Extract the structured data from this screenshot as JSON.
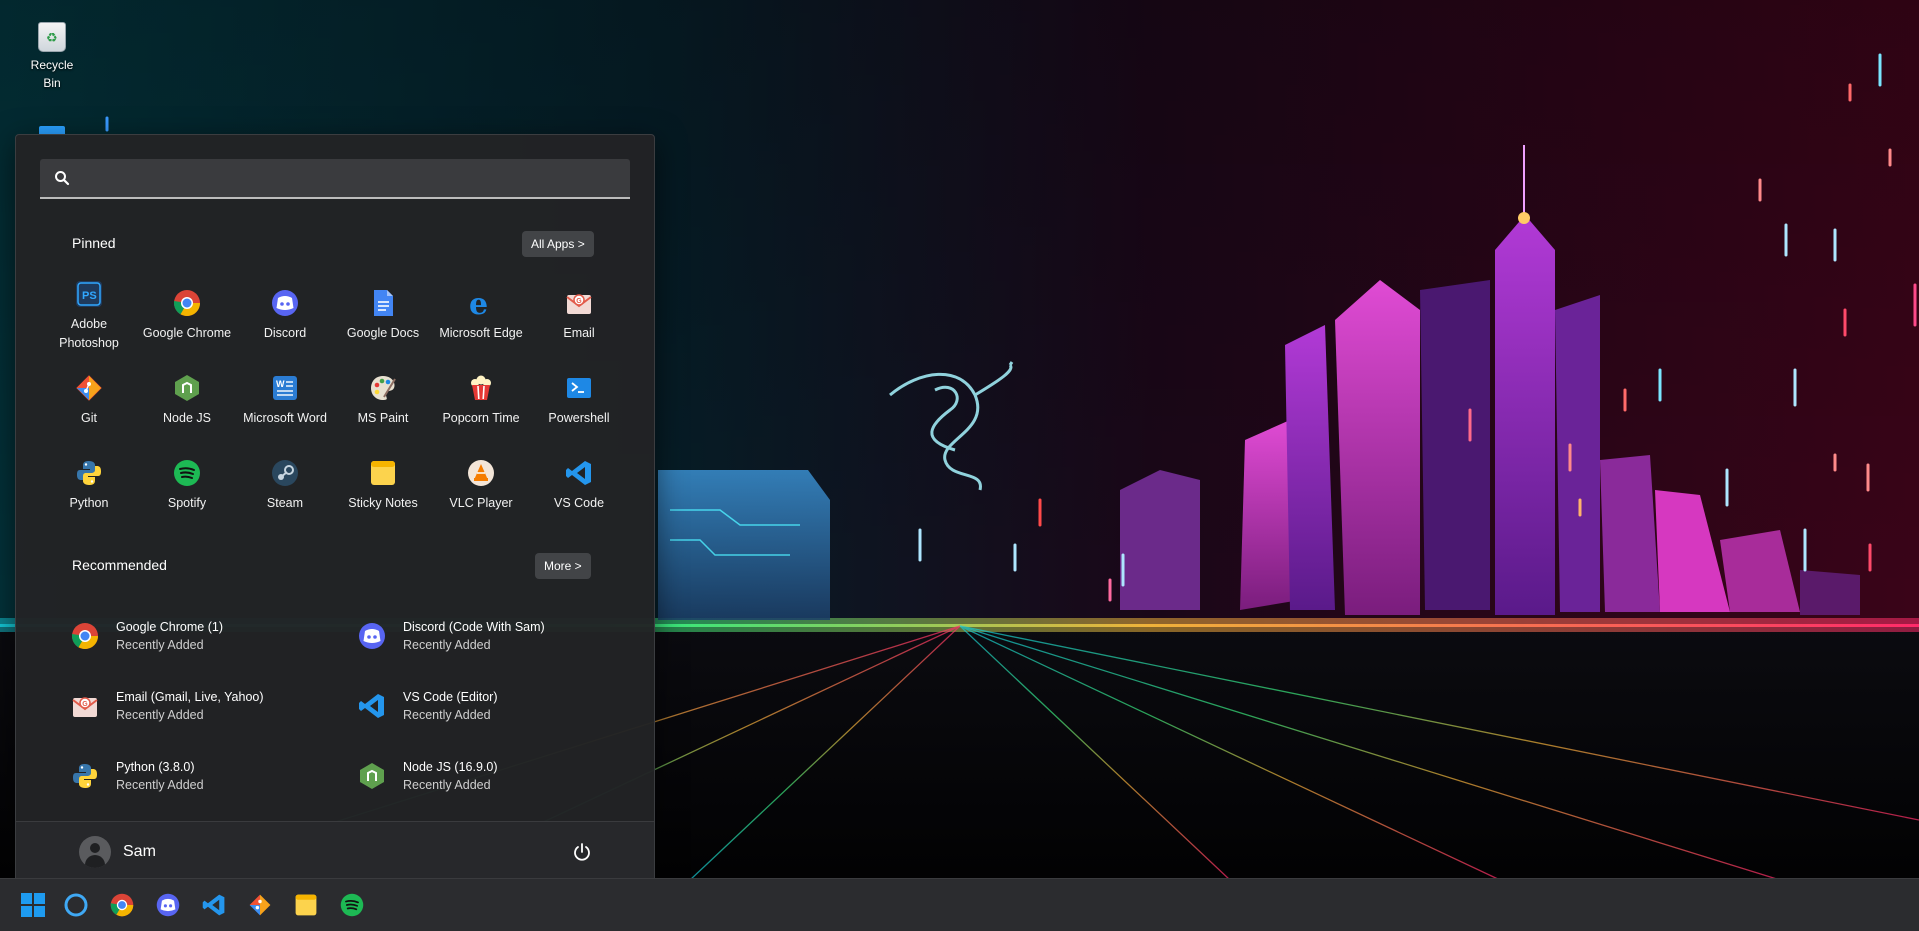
{
  "desktop": {
    "recycle_bin_label": "Recycle Bin"
  },
  "start_menu": {
    "search": {
      "placeholder": "",
      "value": ""
    },
    "pinned": {
      "title": "Pinned",
      "all_apps_label": "All Apps >",
      "apps": [
        {
          "label": "Adobe Photoshop",
          "icon": "photoshop-icon"
        },
        {
          "label": "Google Chrome",
          "icon": "chrome-icon"
        },
        {
          "label": "Discord",
          "icon": "discord-icon"
        },
        {
          "label": "Google Docs",
          "icon": "google-docs-icon"
        },
        {
          "label": "Microsoft Edge",
          "icon": "edge-icon"
        },
        {
          "label": "Email",
          "icon": "email-icon"
        },
        {
          "label": "Git",
          "icon": "git-icon"
        },
        {
          "label": "Node JS",
          "icon": "nodejs-icon"
        },
        {
          "label": "Microsoft Word",
          "icon": "word-icon"
        },
        {
          "label": "MS Paint",
          "icon": "paint-icon"
        },
        {
          "label": "Popcorn Time",
          "icon": "popcorn-icon"
        },
        {
          "label": "Powershell",
          "icon": "powershell-icon"
        },
        {
          "label": "Python",
          "icon": "python-icon"
        },
        {
          "label": "Spotify",
          "icon": "spotify-icon"
        },
        {
          "label": "Steam",
          "icon": "steam-icon"
        },
        {
          "label": "Sticky Notes",
          "icon": "sticky-notes-icon"
        },
        {
          "label": "VLC Player",
          "icon": "vlc-icon"
        },
        {
          "label": "VS Code",
          "icon": "vscode-icon"
        }
      ]
    },
    "recommended": {
      "title": "Recommended",
      "more_label": "More >",
      "items": [
        {
          "title": "Google Chrome (1)",
          "subtitle": "Recently Added",
          "icon": "chrome-icon"
        },
        {
          "title": "Discord (Code With Sam)",
          "subtitle": "Recently Added",
          "icon": "discord-icon"
        },
        {
          "title": "Email (Gmail, Live, Yahoo)",
          "subtitle": "Recently Added",
          "icon": "email-icon"
        },
        {
          "title": "VS Code (Editor)",
          "subtitle": "Recently Added",
          "icon": "vscode-icon"
        },
        {
          "title": "Python (3.8.0)",
          "subtitle": "Recently Added",
          "icon": "python-icon"
        },
        {
          "title": "Node JS (16.9.0)",
          "subtitle": "Recently Added",
          "icon": "nodejs-icon"
        }
      ]
    },
    "user": {
      "name": "Sam"
    }
  },
  "taskbar": {
    "items": [
      "windows-start-icon",
      "search-circle-icon",
      "chrome-icon",
      "discord-icon",
      "vscode-icon",
      "git-icon",
      "sticky-notes-icon",
      "spotify-icon"
    ]
  },
  "colors": {
    "menu_bg": "#222325",
    "taskbar_bg": "#2b2c2f",
    "accent": "#2aa0ff"
  }
}
